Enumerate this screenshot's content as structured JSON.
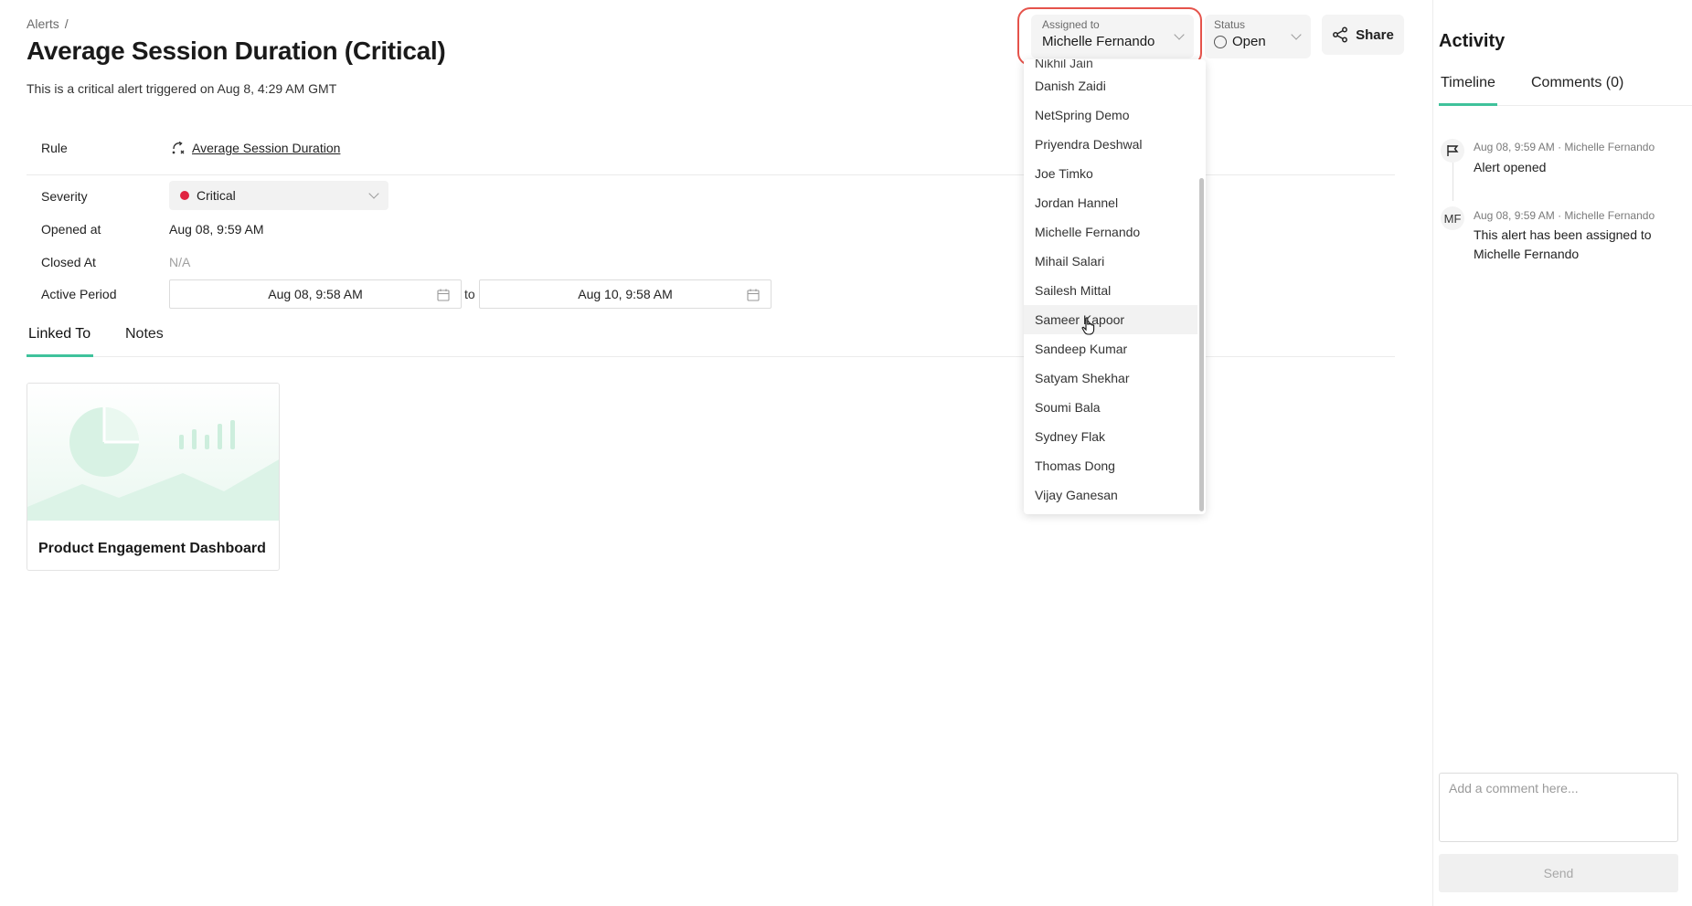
{
  "breadcrumb": {
    "root": "Alerts",
    "separator": "/"
  },
  "page": {
    "title": "Average Session Duration (Critical)",
    "subtitle": "This is a critical alert triggered on Aug 8, 4:29 AM GMT"
  },
  "header": {
    "assigned_caption": "Assigned to",
    "assigned_value": "Michelle Fernando",
    "status_caption": "Status",
    "status_value": "Open",
    "share_label": "Share"
  },
  "dropdown": {
    "partial_item": "Nikhil Jain",
    "options": [
      "Danish Zaidi",
      "NetSpring Demo",
      "Priyendra Deshwal",
      "Joe Timko",
      "Jordan Hannel",
      "Michelle Fernando",
      "Mihail Salari",
      "Sailesh Mittal",
      "Sameer Kapoor",
      "Sandeep Kumar",
      "Satyam Shekhar",
      "Soumi Bala",
      "Sydney Flak",
      "Thomas Dong",
      "Vijay Ganesan"
    ],
    "hovered": "Sameer Kapoor"
  },
  "details": {
    "rule_label": "Rule",
    "rule_value": "Average Session Duration",
    "severity_label": "Severity",
    "severity_value": "Critical",
    "severity_color": "#e0223f",
    "opened_label": "Opened at",
    "opened_value": "Aug 08, 9:59 AM",
    "closed_label": "Closed At",
    "closed_value": "N/A",
    "period_label": "Active Period",
    "period_start": "Aug 08, 9:58 AM",
    "period_to": "to",
    "period_end": "Aug 10, 9:58 AM"
  },
  "tabs": {
    "linked": "Linked To",
    "notes": "Notes"
  },
  "linked_card": {
    "title": "Product Engagement Dashboard"
  },
  "sidebar": {
    "title": "Activity",
    "tabs": {
      "timeline": "Timeline",
      "comments": "Comments (0)"
    },
    "timeline": [
      {
        "meta": "Aug 08, 9:59 AM · Michelle Fernando",
        "text": "Alert opened",
        "icon": "flag-icon"
      },
      {
        "meta": "Aug 08, 9:59 AM · Michelle Fernando",
        "text": "This alert has been assigned to Michelle Fernando",
        "avatar": "MF"
      }
    ],
    "comment_placeholder": "Add a comment here...",
    "send_label": "Send"
  },
  "colors": {
    "accent": "#3fc29b",
    "highlight": "#e5534b"
  }
}
